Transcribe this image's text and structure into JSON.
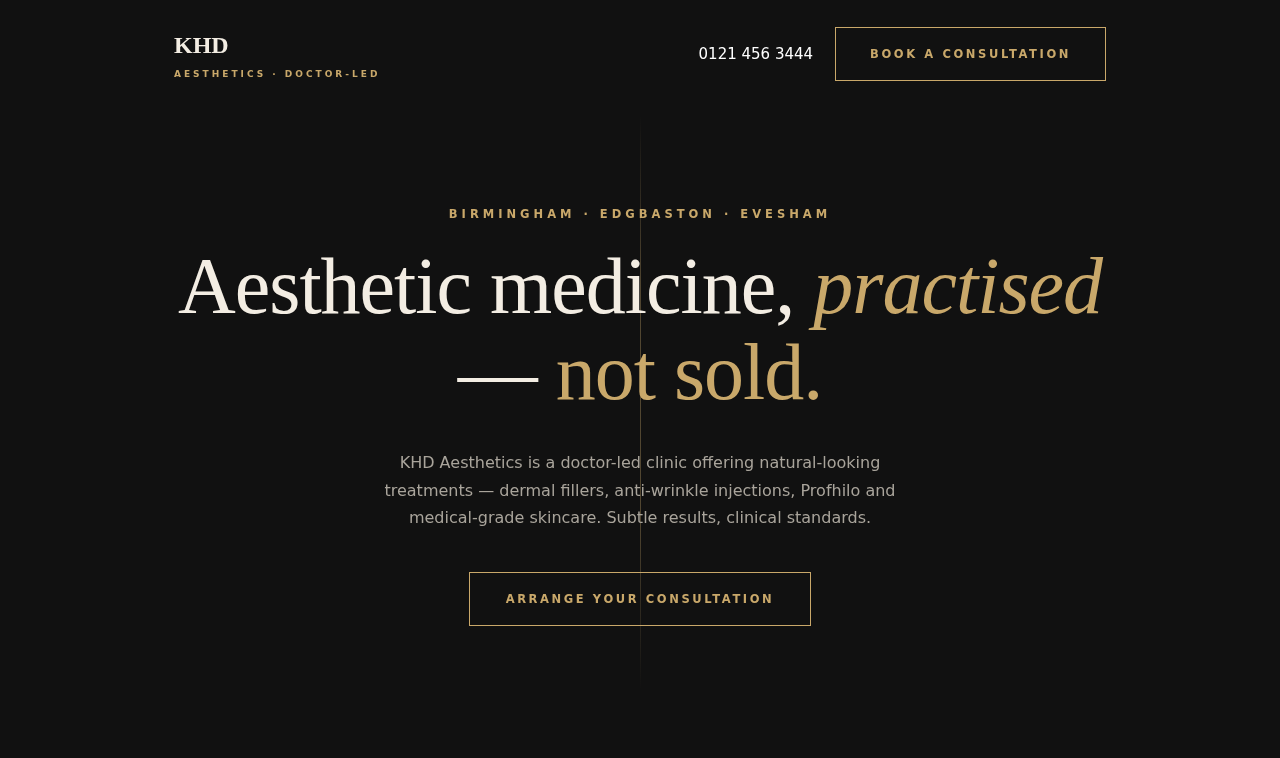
{
  "header": {
    "logo": "KHD",
    "tagline": "AESTHETICS · DOCTOR-LED",
    "phone": "0121 456 3444",
    "cta": "BOOK A CONSULTATION"
  },
  "hero": {
    "locations": "BIRMINGHAM · EDGBASTON · EVESHAM",
    "headline": [
      [
        {
          "text": "Aesthetic medicine, ",
          "kind": "plain"
        },
        {
          "text": "practised",
          "kind": "accent_italic"
        }
      ],
      [
        {
          "text": "— ",
          "kind": "plain"
        },
        {
          "text": "not sold.",
          "kind": "accent"
        }
      ]
    ],
    "intro": "KHD Aesthetics is a doctor-led clinic offering natural-looking treatments — dermal fillers, anti-wrinkle injections, Profhilo and medical-grade skincare. Subtle results, clinical standards.",
    "cta": "ARRANGE YOUR CONSULTATION"
  }
}
